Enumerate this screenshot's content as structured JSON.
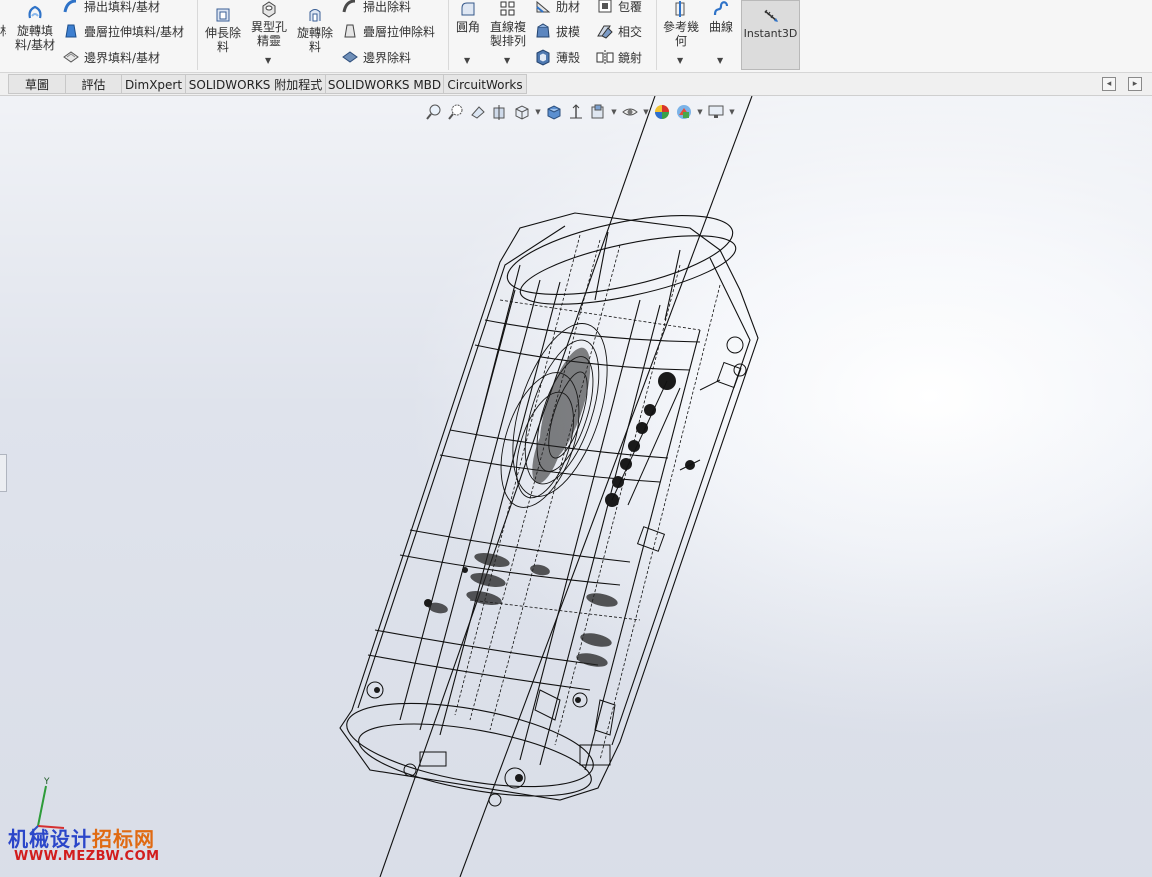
{
  "ribbon": {
    "revolve_boss": "旋轉填\n料/基材",
    "sweep_boss": "掃出填料/基材",
    "loft_boss": "疊層拉伸填料/基材",
    "boundary_boss": "邊界填料/基材",
    "extruded_cut": "伸長除\n料",
    "hole_wizard": "異型孔\n精靈",
    "revolved_cut": "旋轉除\n料",
    "swept_cut": "掃出除料",
    "lofted_cut": "疊層拉伸除料",
    "boundary_cut": "邊界除料",
    "fillet": "圓角",
    "linear_pattern": "直線複\n製排列",
    "rib": "肋材",
    "draft": "拔模",
    "shell": "薄殼",
    "wrap": "包覆",
    "intersect": "相交",
    "mirror": "鏡射",
    "reference_geometry": "參考幾\n何",
    "curves": "曲線",
    "instant3d": "Instant3D"
  },
  "tabs": [
    "草圖",
    "評估",
    "DimXpert",
    "SOLIDWORKS 附加程式",
    "SOLIDWORKS MBD",
    "CircuitWorks"
  ],
  "icons": {
    "headsup": [
      "zoom-to-fit-icon",
      "zoom-to-area-icon",
      "previous-view-icon",
      "section-view-icon",
      "view-orientation-icon",
      "display-style-icon",
      "hide-show-items-icon",
      "edit-appearance-icon",
      "apply-scene-icon",
      "view-settings-icon"
    ]
  },
  "watermark": {
    "line1_a": "机械设计",
    "line1_b": "招标网",
    "line2": "WWW.MEZBW.COM"
  },
  "triad": {
    "y_label": "Y"
  },
  "colors": {
    "ribbon_bg": "#f6f6f6",
    "instant3d_active": "#dcdcdc",
    "watermark_blue": "#2b46c9",
    "watermark_orange": "#e06a12",
    "watermark_red": "#d21d1d"
  }
}
